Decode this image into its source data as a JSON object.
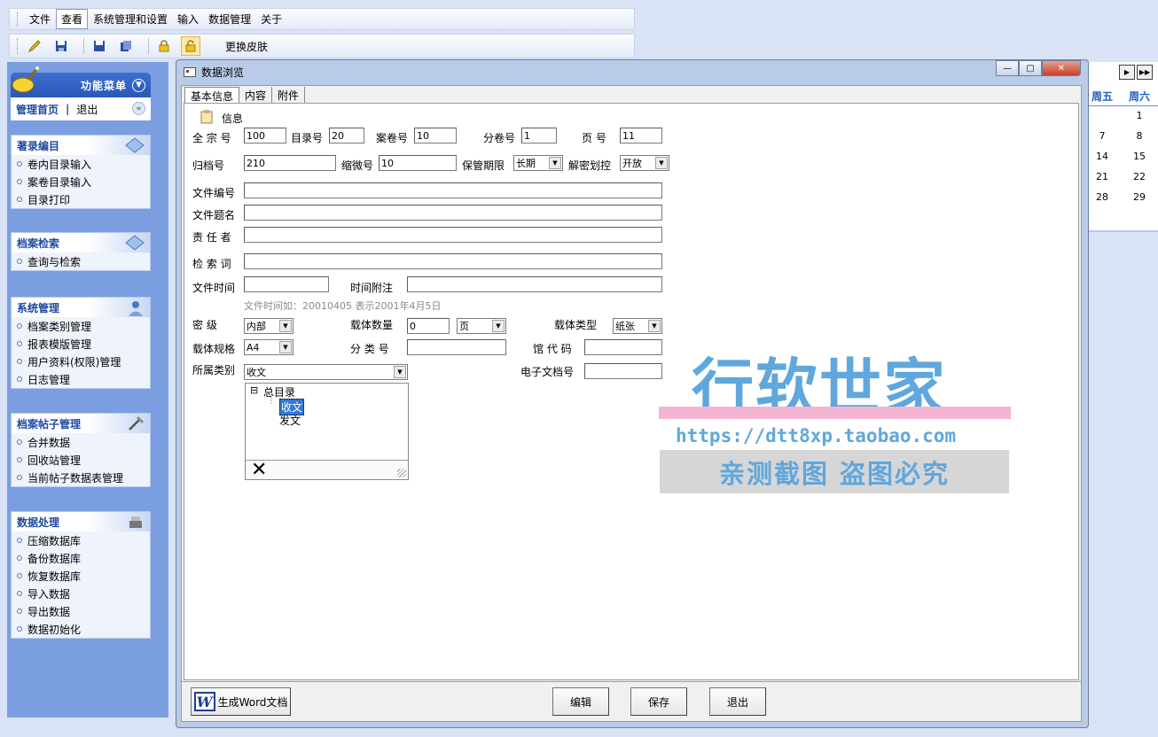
{
  "menubar": {
    "items": [
      "文件",
      "查看",
      "系统管理和设置",
      "输入",
      "数据管理",
      "关于"
    ],
    "active_index": 1
  },
  "toolbar": {
    "skin_label": "更换皮肤"
  },
  "sidebar": {
    "header_title": "功能菜单",
    "nav_home": "管理首页",
    "nav_sep": "|",
    "nav_exit": "退出",
    "groups": [
      {
        "title": "著录编目",
        "items": [
          "卷内目录输入",
          "案卷目录输入",
          "目录打印"
        ]
      },
      {
        "title": "档案检索",
        "items": [
          "查询与检索"
        ]
      },
      {
        "title": "系统管理",
        "items": [
          "档案类别管理",
          "报表模版管理",
          "用户资料(权限)管理",
          "日志管理"
        ]
      },
      {
        "title": "档案帖子管理",
        "items": [
          "合并数据",
          "回收站管理",
          "当前帖子数据表管理"
        ]
      },
      {
        "title": "数据处理",
        "items": [
          "压缩数据库",
          "备份数据库",
          "恢复数据库",
          "导入数据",
          "导出数据",
          "数据初始化"
        ]
      }
    ]
  },
  "calendar": {
    "headers": [
      "周五",
      "周六"
    ],
    "rows": [
      [
        "",
        "1"
      ],
      [
        "7",
        "8"
      ],
      [
        "14",
        "15"
      ],
      [
        "21",
        "22"
      ],
      [
        "28",
        "29"
      ]
    ]
  },
  "window": {
    "title": "数据浏览",
    "tabs": [
      "基本信息",
      "内容",
      "附件"
    ],
    "section_label": "信息",
    "fields": {
      "quanzong_label": "全 宗 号",
      "quanzong_value": "100",
      "mulu_label": "目录号",
      "mulu_value": "20",
      "anjuan_label": "案卷号",
      "anjuan_value": "10",
      "fenjuan_label": "分卷号",
      "fenjuan_value": "1",
      "ye_label": "页  号",
      "ye_value": "11",
      "guidang_label": "归档号",
      "guidang_value": "210",
      "suowei_label": "缩微号",
      "suowei_value": "10",
      "baoguan_label": "保管期限",
      "baoguan_value": "长期",
      "jiemi_label": "解密划控",
      "jiemi_value": "开放",
      "wenjianbianhao_label": "文件编号",
      "wenjianbianhao_value": "",
      "timing_label": "文件题名",
      "timing_value": "",
      "zeren_label": "责 任 者",
      "zeren_value": "",
      "jiansuo_label": "检 索 词",
      "jiansuo_value": "",
      "shijian_label": "文件时间",
      "shijian_value": "",
      "fuzhu_label": "时间附注",
      "fuzhu_value": "",
      "time_hint": "文件时间如：20010405 表示2001年4月5日",
      "miji_label": "密    级",
      "miji_value": "内部",
      "zaiti_shu_label": "载体数量",
      "zaiti_shu_value": "0",
      "zaiti_unit": "页",
      "zaiti_type_label": "载体类型",
      "zaiti_type_value": "纸张",
      "guige_label": "载体规格",
      "guige_value": "A4",
      "fenlei_label": "分 类 号",
      "fenlei_value": "",
      "guandai_label": "馆 代 码",
      "guandai_value": "",
      "suoshu_label": "所属类别",
      "suoshu_value": "收文",
      "dianzi_label": "电子文档号",
      "dianzi_value": ""
    },
    "tree": {
      "root": "总目录",
      "expander": "⊟",
      "children": [
        "收文",
        "发文"
      ],
      "selected_index": 0,
      "close_glyph": "✕"
    },
    "buttons": {
      "word": "生成Word文档",
      "word_icon": "W",
      "edit": "编辑",
      "save": "保存",
      "exit": "退出"
    }
  },
  "watermark": {
    "title": "行软世家",
    "url": "https://dtt8xp.taobao.com",
    "notice": "亲测截图 盗图必究"
  }
}
